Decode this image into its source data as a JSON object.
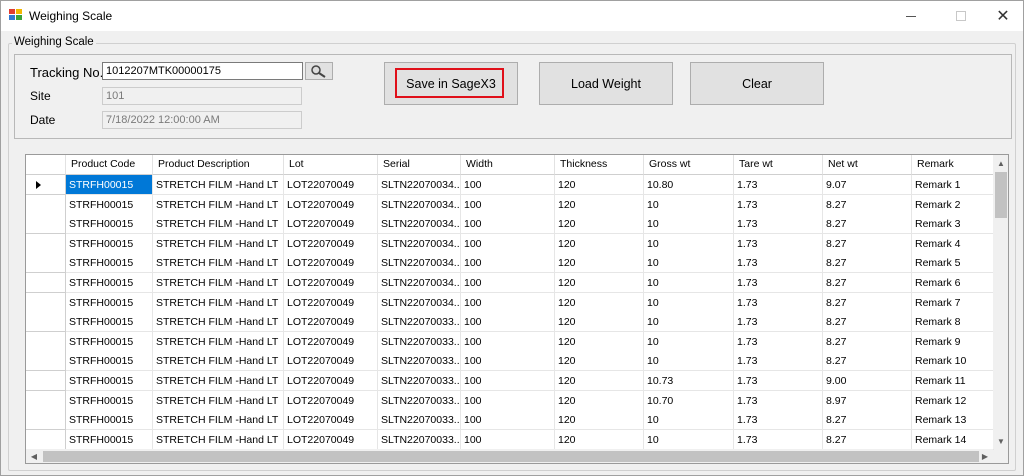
{
  "window": {
    "title": "Weighing Scale",
    "icon": "app-icon",
    "controls": {
      "minimize_icon": "minimize-icon",
      "maximize_icon": "maximize-icon",
      "close_icon": "close-icon"
    }
  },
  "group": {
    "label": "Weighing Scale"
  },
  "form": {
    "tracking_label": "Tracking No.",
    "tracking_value": "1012207MTK00000175",
    "search_icon": "magnifier-icon",
    "site_label": "Site",
    "site_value": "101",
    "date_label": "Date",
    "date_value": "7/18/2022 12:00:00 AM"
  },
  "buttons": {
    "save_label": "Save in SageX3",
    "load_label": "Load Weight",
    "clear_label": "Clear",
    "highlight_color": "#e0101a"
  },
  "grid": {
    "columns": [
      "Product Code",
      "Product Description",
      "Lot",
      "Serial",
      "Width",
      "Thickness",
      "Gross wt",
      "Tare wt",
      "Net wt",
      "Remark"
    ],
    "current_row_icon": "current-row-arrow-icon",
    "selection_color": "#0078d7",
    "rows": [
      [
        "STRFH00015",
        "STRETCH FILM -Hand LT",
        "LOT22070049",
        "SLTN22070034...",
        "100",
        "120",
        "10.80",
        "1.73",
        "9.07",
        "Remark 1"
      ],
      [
        "STRFH00015",
        "STRETCH FILM -Hand LT",
        "LOT22070049",
        "SLTN22070034...",
        "100",
        "120",
        "10",
        "1.73",
        "8.27",
        "Remark 2"
      ],
      [
        "STRFH00015",
        "STRETCH FILM -Hand LT",
        "LOT22070049",
        "SLTN22070034...",
        "100",
        "120",
        "10",
        "1.73",
        "8.27",
        "Remark 3"
      ],
      [
        "STRFH00015",
        "STRETCH FILM -Hand LT",
        "LOT22070049",
        "SLTN22070034...",
        "100",
        "120",
        "10",
        "1.73",
        "8.27",
        "Remark 4"
      ],
      [
        "STRFH00015",
        "STRETCH FILM -Hand LT",
        "LOT22070049",
        "SLTN22070034...",
        "100",
        "120",
        "10",
        "1.73",
        "8.27",
        "Remark 5"
      ],
      [
        "STRFH00015",
        "STRETCH FILM -Hand LT",
        "LOT22070049",
        "SLTN22070034...",
        "100",
        "120",
        "10",
        "1.73",
        "8.27",
        "Remark 6"
      ],
      [
        "STRFH00015",
        "STRETCH FILM -Hand LT",
        "LOT22070049",
        "SLTN22070034...",
        "100",
        "120",
        "10",
        "1.73",
        "8.27",
        "Remark 7"
      ],
      [
        "STRFH00015",
        "STRETCH FILM -Hand LT",
        "LOT22070049",
        "SLTN22070033...",
        "100",
        "120",
        "10",
        "1.73",
        "8.27",
        "Remark 8"
      ],
      [
        "STRFH00015",
        "STRETCH FILM -Hand LT",
        "LOT22070049",
        "SLTN22070033...",
        "100",
        "120",
        "10",
        "1.73",
        "8.27",
        "Remark 9"
      ],
      [
        "STRFH00015",
        "STRETCH FILM -Hand LT",
        "LOT22070049",
        "SLTN22070033...",
        "100",
        "120",
        "10",
        "1.73",
        "8.27",
        "Remark 10"
      ],
      [
        "STRFH00015",
        "STRETCH FILM -Hand LT",
        "LOT22070049",
        "SLTN22070033...",
        "100",
        "120",
        "10.73",
        "1.73",
        "9.00",
        "Remark 11"
      ],
      [
        "STRFH00015",
        "STRETCH FILM -Hand LT",
        "LOT22070049",
        "SLTN22070033...",
        "100",
        "120",
        "10.70",
        "1.73",
        "8.97",
        "Remark 12"
      ],
      [
        "STRFH00015",
        "STRETCH FILM -Hand LT",
        "LOT22070049",
        "SLTN22070033...",
        "100",
        "120",
        "10",
        "1.73",
        "8.27",
        "Remark 13"
      ],
      [
        "STRFH00015",
        "STRETCH FILM -Hand LT",
        "LOT22070049",
        "SLTN22070033...",
        "100",
        "120",
        "10",
        "1.73",
        "8.27",
        "Remark 14"
      ]
    ]
  },
  "scrollbars": {
    "up_icon": "scroll-up-icon",
    "down_icon": "scroll-down-icon",
    "left_icon": "scroll-left-icon",
    "right_icon": "scroll-right-icon"
  }
}
